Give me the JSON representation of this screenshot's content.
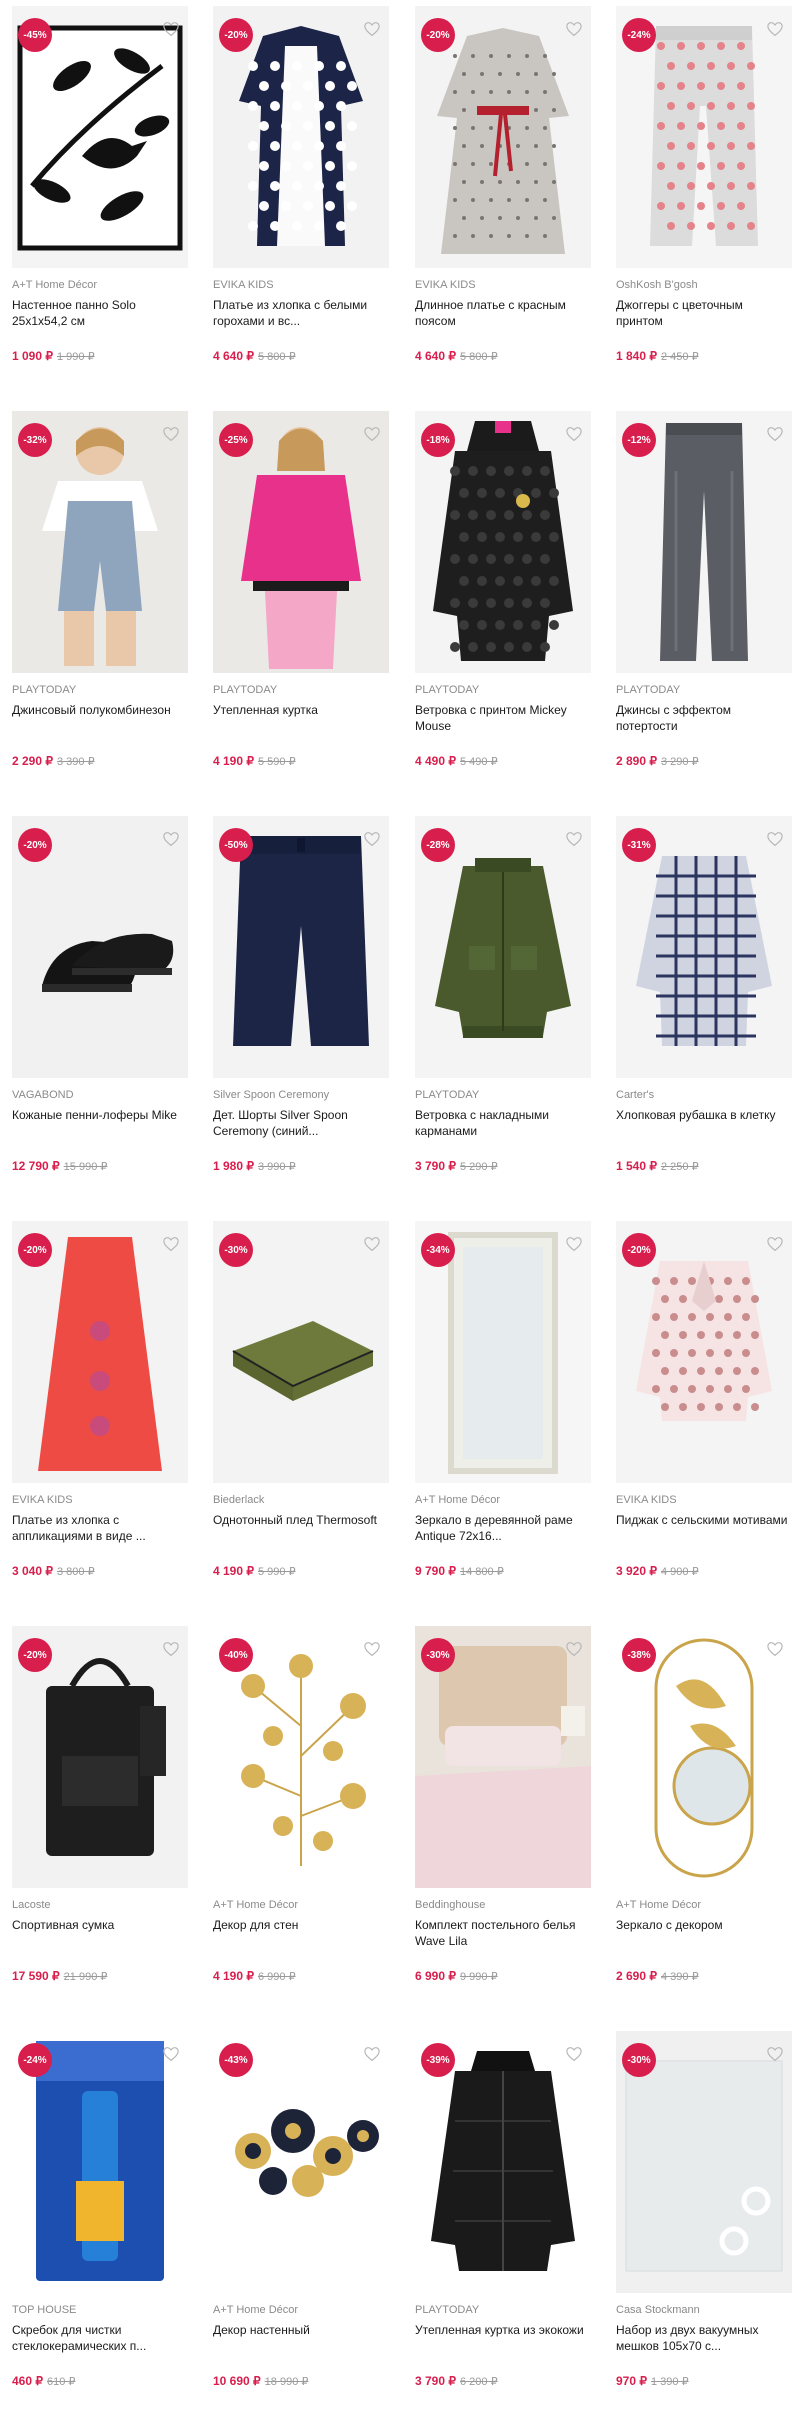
{
  "colors": {
    "accent": "#d81e4c",
    "brand_text": "#8a8a8a",
    "old_price": "#9a9a9a"
  },
  "favorite_icon": "heart-outline-icon",
  "products": [
    {
      "discount": "-45%",
      "brand": "A+T Home Décor",
      "title": "Настенное панно Solo 25х1х54,2 см",
      "price": "1 090 ₽",
      "old_price": "1 990 ₽",
      "image": "wall-panel-birds"
    },
    {
      "discount": "-20%",
      "brand": "EVIKA KIDS",
      "title": "Платье из хлопка с белыми горохами и вс...",
      "price": "4 640 ₽",
      "old_price": "5 800 ₽",
      "image": "polka-dot-dress"
    },
    {
      "discount": "-20%",
      "brand": "EVIKA KIDS",
      "title": "Длинное платье с красным поясом",
      "price": "4 640 ₽",
      "old_price": "5 800 ₽",
      "image": "long-dress-red-belt"
    },
    {
      "discount": "-24%",
      "brand": "OshKosh B'gosh",
      "title": "Джоггеры с цветочным принтом",
      "price": "1 840 ₽",
      "old_price": "2 450 ₽",
      "image": "floral-joggers"
    },
    {
      "discount": "-32%",
      "brand": "PLAYTODAY",
      "title": "Джинсовый полукомбинезон",
      "price": "2 290 ₽",
      "old_price": "3 390 ₽",
      "image": "denim-overalls"
    },
    {
      "discount": "-25%",
      "brand": "PLAYTODAY",
      "title": "Утепленная куртка",
      "price": "4 190 ₽",
      "old_price": "5 590 ₽",
      "image": "pink-jacket"
    },
    {
      "discount": "-18%",
      "brand": "PLAYTODAY",
      "title": "Ветровка с принтом Mickey Mouse",
      "price": "4 490 ₽",
      "old_price": "5 490 ₽",
      "image": "black-windbreaker"
    },
    {
      "discount": "-12%",
      "brand": "PLAYTODAY",
      "title": "Джинсы с эффектом потертости",
      "price": "2 890 ₽",
      "old_price": "3 290 ₽",
      "image": "grey-jeans"
    },
    {
      "discount": "-20%",
      "brand": "VAGABOND",
      "title": "Кожаные пенни-лоферы Mike",
      "price": "12 790 ₽",
      "old_price": "15 990 ₽",
      "image": "loafers"
    },
    {
      "discount": "-50%",
      "brand": "Silver Spoon Ceremony",
      "title": "Дет. Шорты Silver Spoon Ceremony (синий...",
      "price": "1 980 ₽",
      "old_price": "3 990 ₽",
      "image": "navy-shorts"
    },
    {
      "discount": "-28%",
      "brand": "PLAYTODAY",
      "title": "Ветровка с накладными карманами",
      "price": "3 790 ₽",
      "old_price": "5 290 ₽",
      "image": "green-bomber"
    },
    {
      "discount": "-31%",
      "brand": "Carter's",
      "title": "Хлопковая рубашка в клетку",
      "price": "1 540 ₽",
      "old_price": "2 250 ₽",
      "image": "check-shirt"
    },
    {
      "discount": "-20%",
      "brand": "EVIKA KIDS",
      "title": "Платье из хлопка с аппликациями в виде ...",
      "price": "3 040 ₽",
      "old_price": "3 800 ₽",
      "image": "red-dress"
    },
    {
      "discount": "-30%",
      "brand": "Biederlack",
      "title": "Однотонный плед Thermosoft",
      "price": "4 190 ₽",
      "old_price": "5 990 ₽",
      "image": "olive-blanket"
    },
    {
      "discount": "-34%",
      "brand": "A+T Home Décor",
      "title": "Зеркало в деревянной раме Antique 72х16...",
      "price": "9 790 ₽",
      "old_price": "14 800 ₽",
      "image": "wood-mirror"
    },
    {
      "discount": "-20%",
      "brand": "EVIKA KIDS",
      "title": "Пиджак с сельскими мотивами",
      "price": "3 920 ₽",
      "old_price": "4 900 ₽",
      "image": "pattern-blazer"
    },
    {
      "discount": "-20%",
      "brand": "Lacoste",
      "title": "Спортивная сумка",
      "price": "17 590 ₽",
      "old_price": "21 990 ₽",
      "image": "black-bag"
    },
    {
      "discount": "-40%",
      "brand": "A+T Home Décor",
      "title": "Декор для стен",
      "price": "4 190 ₽",
      "old_price": "6 990 ₽",
      "image": "gold-leaves"
    },
    {
      "discount": "-30%",
      "brand": "Beddinghouse",
      "title": "Комплект постельного белья Wave Lila",
      "price": "6 990 ₽",
      "old_price": "9 990 ₽",
      "image": "bedding"
    },
    {
      "discount": "-38%",
      "brand": "A+T Home Décor",
      "title": "Зеркало с декором",
      "price": "2 690 ₽",
      "old_price": "4 390 ₽",
      "image": "gold-mirror"
    },
    {
      "discount": "-24%",
      "brand": "TOP HOUSE",
      "title": "Скребок для чистки стеклокерамических п...",
      "price": "460 ₽",
      "old_price": "610 ₽",
      "image": "scraper"
    },
    {
      "discount": "-43%",
      "brand": "A+T Home Décor",
      "title": "Декор настенный",
      "price": "10 690 ₽",
      "old_price": "18 990 ₽",
      "image": "flower-decor"
    },
    {
      "discount": "-39%",
      "brand": "PLAYTODAY",
      "title": "Утепленная куртка из экокожи",
      "price": "3 790 ₽",
      "old_price": "6 200 ₽",
      "image": "black-puffer"
    },
    {
      "discount": "-30%",
      "brand": "Casa Stockmann",
      "title": "Набор из двух вакуумных мешков 105х70 с...",
      "price": "970 ₽",
      "old_price": "1 390 ₽",
      "image": "vacuum-bags"
    }
  ]
}
